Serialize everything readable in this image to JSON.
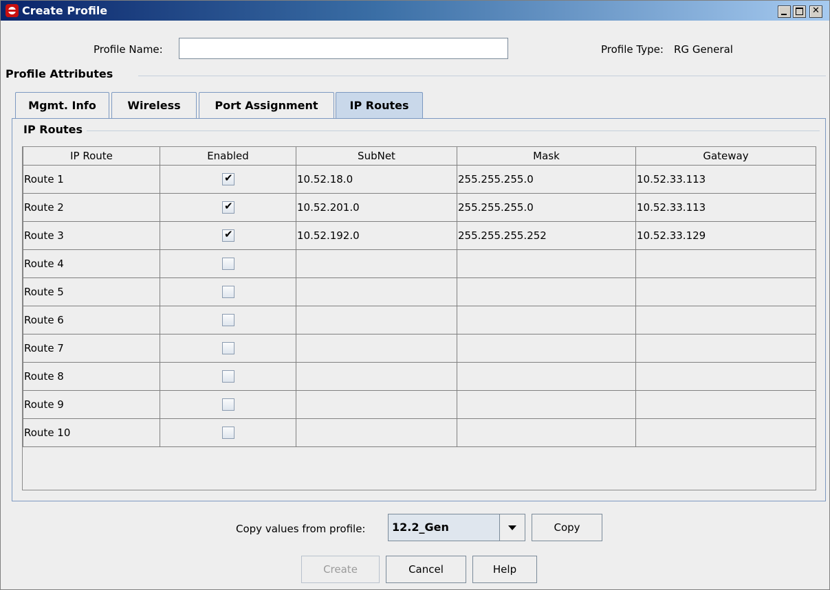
{
  "window": {
    "title": "Create Profile"
  },
  "form": {
    "profile_name_label": "Profile Name:",
    "profile_name_value": "",
    "profile_type_label": "Profile Type:",
    "profile_type_value": "RG General"
  },
  "profile_attributes": {
    "heading": "Profile Attributes",
    "tabs": [
      {
        "label": "Mgmt. Info"
      },
      {
        "label": "Wireless"
      },
      {
        "label": "Port Assignment"
      },
      {
        "label": "IP Routes",
        "active": true
      }
    ],
    "group_title": "IP Routes"
  },
  "table": {
    "columns": [
      "IP Route",
      "Enabled",
      "SubNet",
      "Mask",
      "Gateway"
    ],
    "rows": [
      {
        "route": "Route 1",
        "enabled": true,
        "subnet": "10.52.18.0",
        "mask": "255.255.255.0",
        "gateway": "10.52.33.113"
      },
      {
        "route": "Route 2",
        "enabled": true,
        "subnet": "10.52.201.0",
        "mask": "255.255.255.0",
        "gateway": "10.52.33.113"
      },
      {
        "route": "Route 3",
        "enabled": true,
        "subnet": "10.52.192.0",
        "mask": "255.255.255.252",
        "gateway": "10.52.33.129"
      },
      {
        "route": "Route 4",
        "enabled": false,
        "subnet": "",
        "mask": "",
        "gateway": ""
      },
      {
        "route": "Route 5",
        "enabled": false,
        "subnet": "",
        "mask": "",
        "gateway": ""
      },
      {
        "route": "Route 6",
        "enabled": false,
        "subnet": "",
        "mask": "",
        "gateway": ""
      },
      {
        "route": "Route 7",
        "enabled": false,
        "subnet": "",
        "mask": "",
        "gateway": ""
      },
      {
        "route": "Route 8",
        "enabled": false,
        "subnet": "",
        "mask": "",
        "gateway": ""
      },
      {
        "route": "Route 9",
        "enabled": false,
        "subnet": "",
        "mask": "",
        "gateway": ""
      },
      {
        "route": "Route 10",
        "enabled": false,
        "subnet": "",
        "mask": "",
        "gateway": ""
      }
    ]
  },
  "footer": {
    "copy_label": "Copy values from profile:",
    "copy_select_value": "12.2_Gen",
    "copy_button": "Copy",
    "create_button": "Create",
    "create_disabled": true,
    "cancel_button": "Cancel",
    "help_button": "Help"
  }
}
